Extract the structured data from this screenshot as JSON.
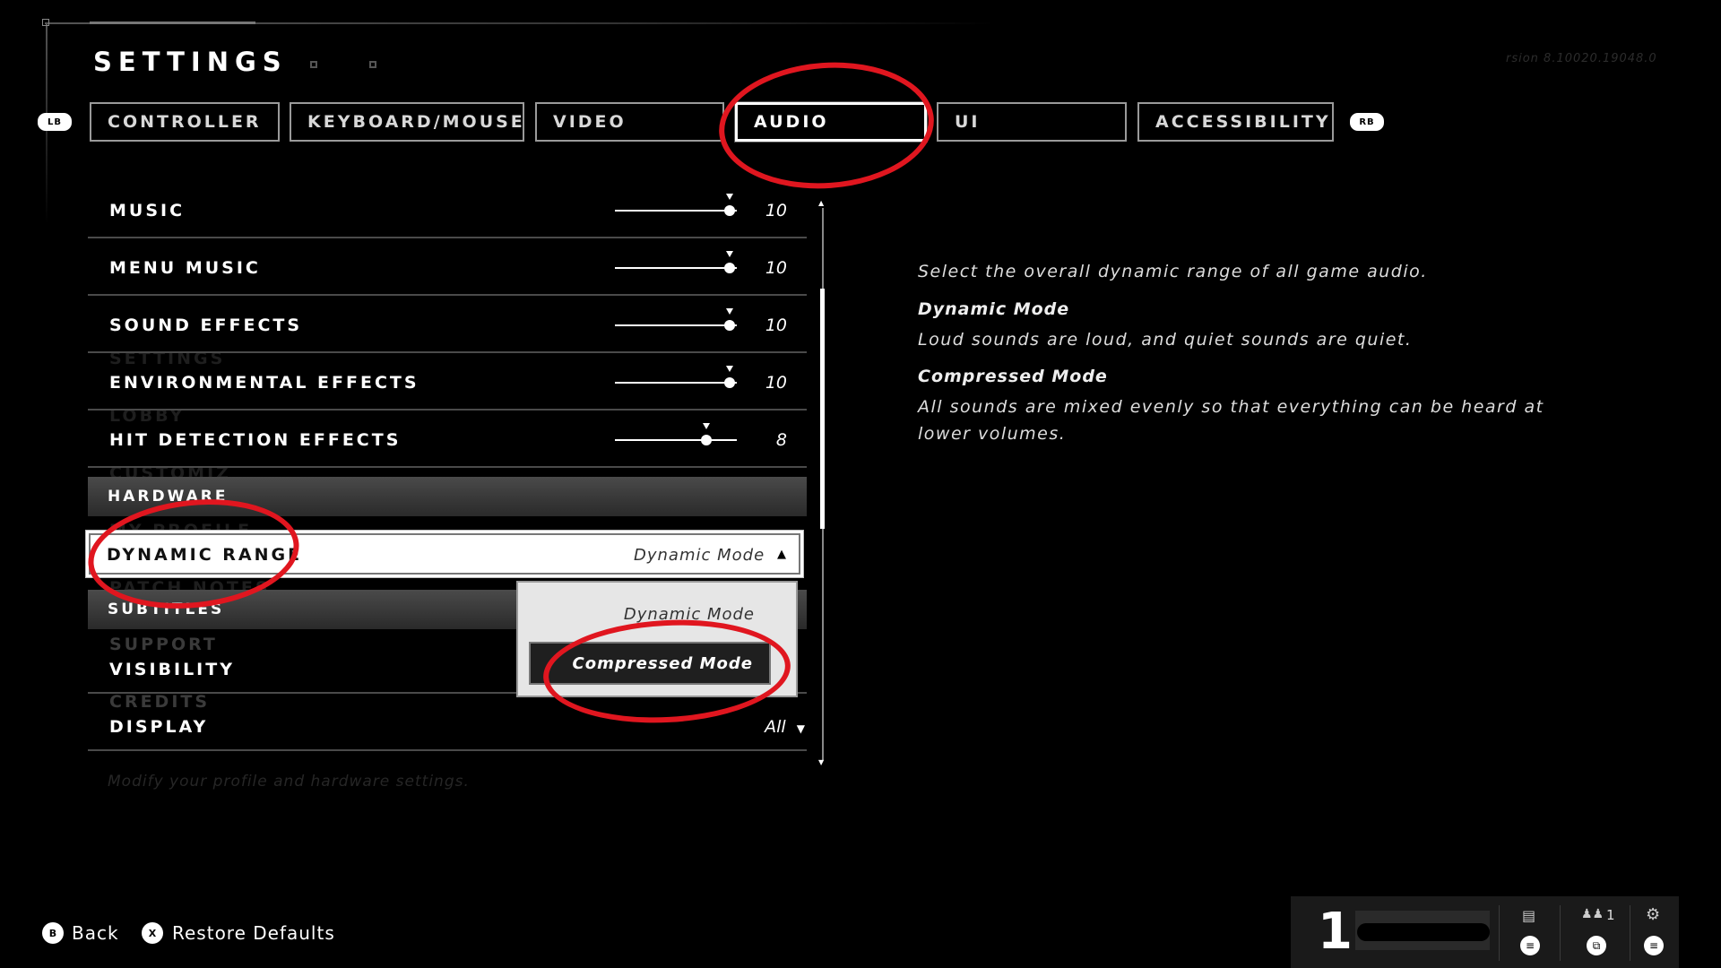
{
  "header": {
    "title": "SETTINGS",
    "version_text": "rsion 8.10020.19048.0"
  },
  "bumpers": {
    "left": "LB",
    "right": "RB"
  },
  "tabs": [
    {
      "label": "CONTROLLER"
    },
    {
      "label": "KEYBOARD/MOUSE"
    },
    {
      "label": "VIDEO"
    },
    {
      "label": "AUDIO",
      "active": true
    },
    {
      "label": "UI"
    },
    {
      "label": "ACCESSIBILITY"
    }
  ],
  "sliders": [
    {
      "label": "MUSIC",
      "value": "10",
      "level": 10
    },
    {
      "label": "MENU MUSIC",
      "value": "10",
      "level": 10
    },
    {
      "label": "SOUND EFFECTS",
      "value": "10",
      "level": 10
    },
    {
      "label": "ENVIRONMENTAL EFFECTS",
      "value": "10",
      "level": 10
    },
    {
      "label": "HIT DETECTION EFFECTS",
      "value": "8",
      "level": 8
    }
  ],
  "sections": {
    "hardware": "HARDWARE",
    "subtitles": "SUBTITLES"
  },
  "dynamic_range": {
    "label": "DYNAMIC RANGE",
    "value": "Dynamic Mode",
    "options": [
      "Dynamic Mode",
      "Compressed Mode"
    ],
    "highlighted": "Compressed Mode"
  },
  "subtitle_rows": [
    {
      "label": "VISIBILITY"
    },
    {
      "label": "DISPLAY",
      "value": "All"
    }
  ],
  "ghost_menu": [
    "SETTINGS",
    "LOBBY",
    "CUSTOMIZ",
    "MY PROFILE",
    "PATCH NOTES",
    "SUPPORT",
    "CREDITS"
  ],
  "ghost_footer": "Modify your profile and hardware settings.",
  "description": {
    "intro": "Select the overall dynamic range of all game audio.",
    "mode1_title": "Dynamic Mode",
    "mode1_text": "Loud sounds are loud, and quiet sounds are quiet.",
    "mode2_title": "Compressed Mode",
    "mode2_text": "All sounds are mixed evenly so that everything can be heard at lower volumes."
  },
  "bottom_actions": {
    "back_key": "B",
    "back_label": "Back",
    "restore_key": "X",
    "restore_label": "Restore Defaults"
  },
  "hud": {
    "player_number": "1",
    "party_count": "1",
    "icons": [
      "chat-icon",
      "party-icon",
      "gear-icon"
    ]
  },
  "colors": {
    "annotation": "#e0161f",
    "background": "#000000"
  }
}
